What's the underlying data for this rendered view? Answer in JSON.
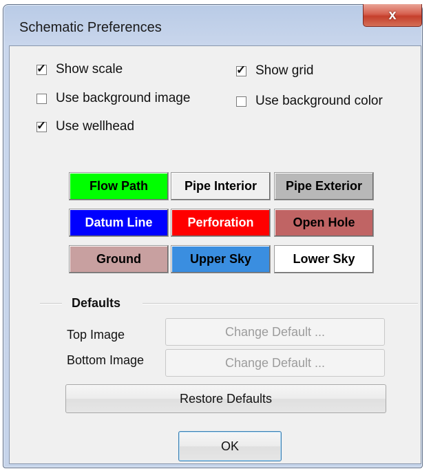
{
  "window": {
    "title": "Schematic Preferences",
    "close_glyph": "x"
  },
  "checkboxes": {
    "show_scale": {
      "label": "Show scale",
      "checked": true
    },
    "show_grid": {
      "label": "Show grid",
      "checked": true
    },
    "use_bg_image": {
      "label": "Use background image",
      "checked": false
    },
    "use_bg_color": {
      "label": "Use background color",
      "checked": false
    },
    "use_wellhead": {
      "label": "Use wellhead",
      "checked": true
    },
    "check_mark": "✓"
  },
  "swatches": [
    {
      "label": "Flow Path",
      "bg": "#00ff00",
      "fg": "#000000"
    },
    {
      "label": "Pipe Interior",
      "bg": "#f0f0f0",
      "fg": "#000000"
    },
    {
      "label": "Pipe Exterior",
      "bg": "#b8b8b8",
      "fg": "#000000"
    },
    {
      "label": "Datum Line",
      "bg": "#0000ff",
      "fg": "#ffffff"
    },
    {
      "label": "Perforation",
      "bg": "#ff0000",
      "fg": "#ffffff"
    },
    {
      "label": "Open Hole",
      "bg": "#c06464",
      "fg": "#000000"
    },
    {
      "label": "Ground",
      "bg": "#c8a0a0",
      "fg": "#000000"
    },
    {
      "label": "Upper Sky",
      "bg": "#3a8ee0",
      "fg": "#000000"
    },
    {
      "label": "Lower Sky",
      "bg": "#ffffff",
      "fg": "#000000"
    }
  ],
  "defaults": {
    "group_label": "Defaults",
    "top_image_label": "Top Image",
    "bottom_image_label": "Bottom Image",
    "change_default_label": "Change Default ...",
    "restore_label": "Restore Defaults"
  },
  "ok_label": "OK"
}
